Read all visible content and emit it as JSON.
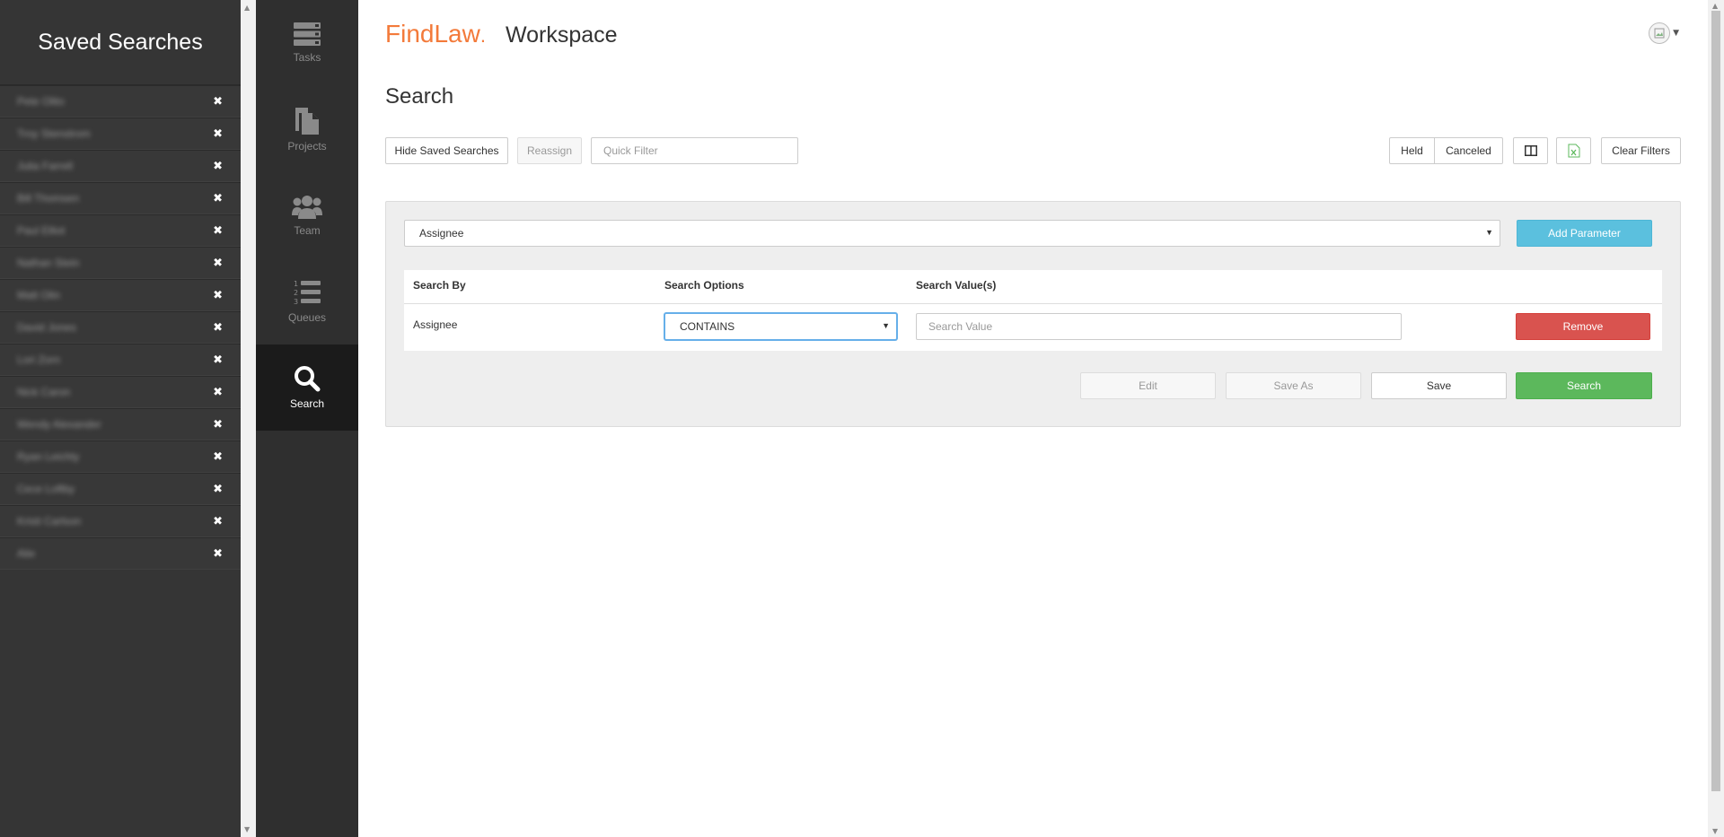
{
  "saved_panel": {
    "title": "Saved Searches",
    "items": [
      {
        "label": "Pete Olito"
      },
      {
        "label": "Troy Stenstrom"
      },
      {
        "label": "Julia Farrell"
      },
      {
        "label": "Bill Thomsen"
      },
      {
        "label": "Paul Elliot"
      },
      {
        "label": "Nathan Stein"
      },
      {
        "label": "Matt Olin"
      },
      {
        "label": "David Jones"
      },
      {
        "label": "Lori Zorn"
      },
      {
        "label": "Nick Caron"
      },
      {
        "label": "Wendy Alexander"
      },
      {
        "label": "Ryan Leichty"
      },
      {
        "label": "Cece Loftby"
      },
      {
        "label": "Kristi Carlson"
      },
      {
        "label": "Alie"
      }
    ],
    "remove_glyph": "✖"
  },
  "nav": {
    "items": [
      {
        "label": "Tasks",
        "icon": "tasks-icon"
      },
      {
        "label": "Projects",
        "icon": "projects-icon"
      },
      {
        "label": "Team",
        "icon": "team-icon"
      },
      {
        "label": "Queues",
        "icon": "queues-icon"
      },
      {
        "label": "Search",
        "icon": "search-icon",
        "active": true
      }
    ]
  },
  "header": {
    "brand": "FindLaw",
    "brand_dot": ".",
    "product": "Workspace"
  },
  "page": {
    "title": "Search"
  },
  "toolbar": {
    "hide_saved": "Hide Saved Searches",
    "reassign": "Reassign",
    "quick_filter_placeholder": "Quick Filter",
    "held": "Held",
    "canceled": "Canceled",
    "clear_filters": "Clear Filters"
  },
  "search_form": {
    "parameter_select": "Assignee",
    "add_parameter": "Add Parameter",
    "columns": {
      "search_by": "Search By",
      "search_options": "Search Options",
      "search_values": "Search Value(s)"
    },
    "row": {
      "search_by": "Assignee",
      "option": "CONTAINS",
      "value_placeholder": "Search Value",
      "remove": "Remove"
    },
    "buttons": {
      "edit": "Edit",
      "save_as": "Save As",
      "save": "Save",
      "search": "Search"
    }
  },
  "colors": {
    "brand": "#f37a3a",
    "info": "#5bc0de",
    "danger": "#d9534f",
    "success": "#5cb85c"
  }
}
